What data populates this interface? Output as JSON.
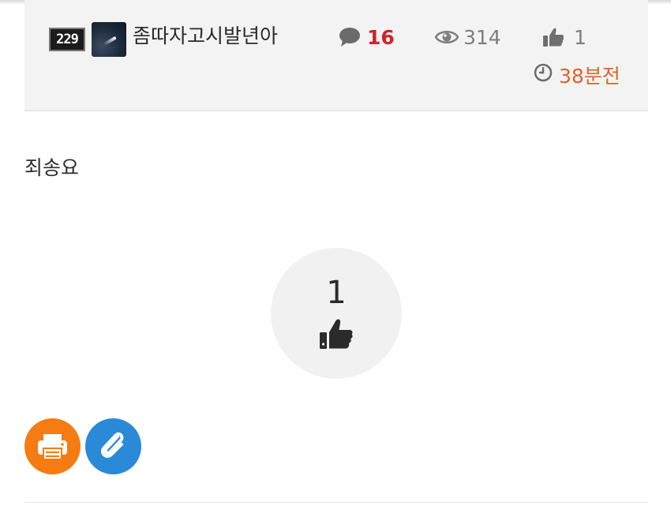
{
  "author": {
    "level": "229",
    "username": "좀따자고시발년아"
  },
  "stats": {
    "comments": "16",
    "views": "314",
    "likes": "1",
    "time_ago": "38분전"
  },
  "post": {
    "body_text": "죄송요"
  },
  "recommend": {
    "count": "1"
  },
  "actions": {
    "print_icon": "print-icon",
    "attach_icon": "paperclip-icon"
  },
  "colors": {
    "comments": "#d0222c",
    "time": "#e2622a",
    "print_button": "#f57b12",
    "attach_button": "#2a8ad7"
  }
}
